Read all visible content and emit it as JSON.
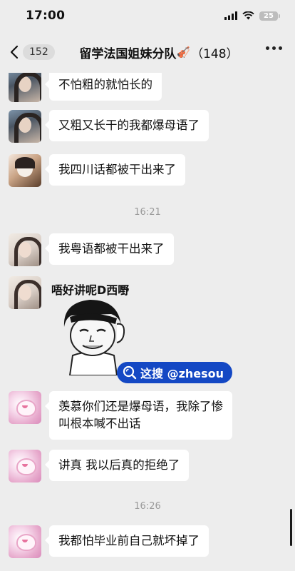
{
  "status_bar": {
    "time": "17:00",
    "battery": "25",
    "icons": [
      "signal-icon",
      "wifi-icon",
      "battery-icon"
    ]
  },
  "nav": {
    "back_icon": "chevron-left-icon",
    "unread_count": "152",
    "title": "留学法国姐妹分队",
    "title_emoji": "🎻",
    "member_count": "（148）",
    "more_icon": "more-dots-icon"
  },
  "messages": [
    {
      "avatar": "girl-avatar",
      "text": "不怕粗的就怕长的"
    },
    {
      "avatar": "girl-avatar",
      "text": "又粗又长干的我都爆母语了"
    },
    {
      "avatar": "cat-girl-avatar",
      "text": "我四川话都被干出来了"
    },
    {
      "avatar": "light-girl-avatar",
      "text": "我粤语都被干出来了"
    },
    {
      "avatar": "light-girl-avatar",
      "text": "唔好讲呢D西嘢"
    },
    {
      "avatar": "pink-cartoon-avatar",
      "text_line1": "羡慕你们还是爆母语，我除了惨",
      "text_line2": "叫根本喊不出话"
    },
    {
      "avatar": "pink-cartoon-avatar",
      "text": "讲真 我以后真的拒绝了"
    },
    {
      "avatar": "pink-cartoon-avatar",
      "text": "我都怕毕业前自己就坏掉了"
    }
  ],
  "timestamps": [
    "16:21",
    "16:26"
  ],
  "watermark": {
    "icon": "search-icon",
    "text": "这搜 @zhesou"
  },
  "colors": {
    "background": "#ededed",
    "bubble": "#ffffff",
    "watermark": "#1448c4"
  }
}
